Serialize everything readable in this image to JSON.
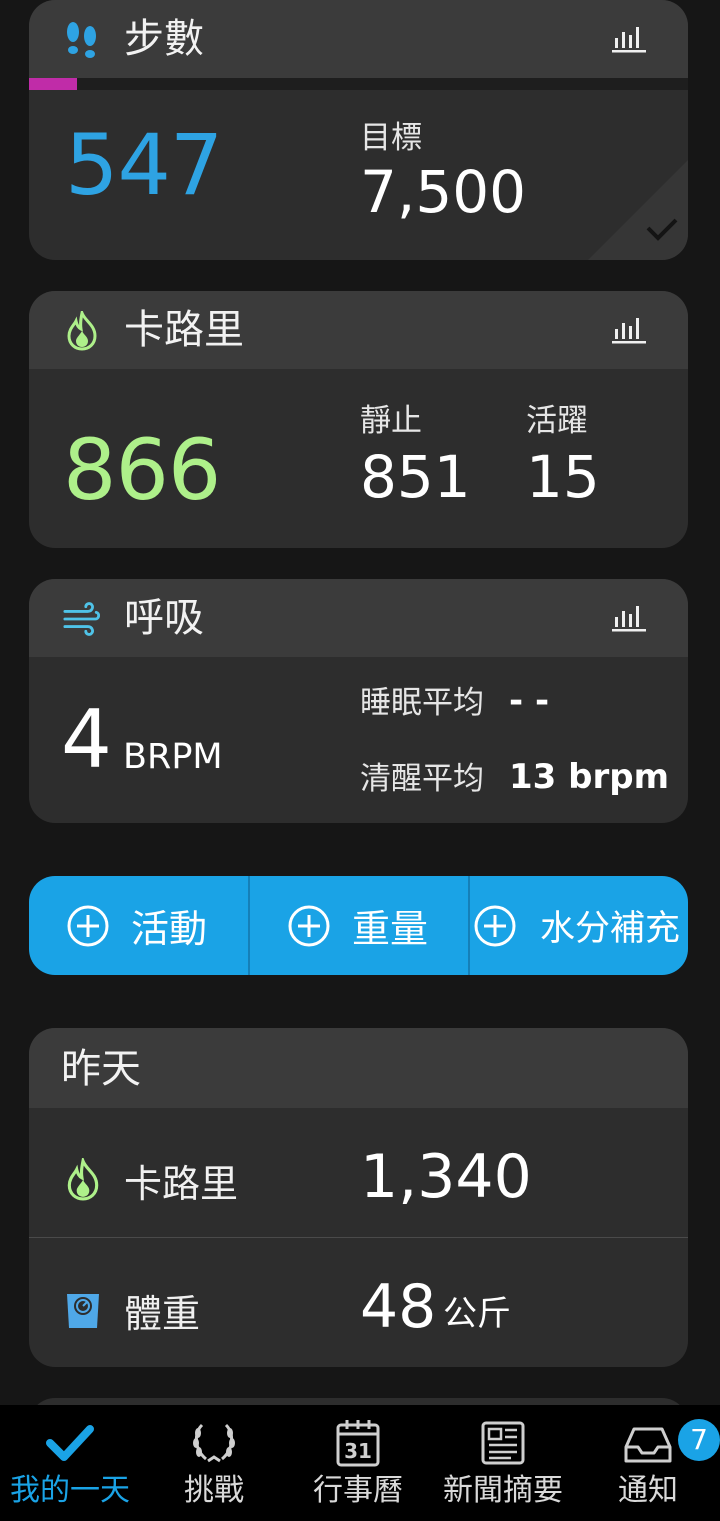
{
  "colors": {
    "accent_blue": "#1aa3e6",
    "steps_blue": "#2ea3e3",
    "calorie_green": "#aef08a",
    "progress_magenta": "#c02ca8",
    "card_bg": "#2d2d2d",
    "header_bg": "#3b3b3b"
  },
  "steps": {
    "icon": "footprints-icon",
    "title": "步數",
    "value": "547",
    "goal_label": "目標",
    "goal_value": "7,500",
    "progress_fraction": 0.073
  },
  "calories": {
    "icon": "flame-icon",
    "title": "卡路里",
    "value": "866",
    "resting_label": "靜止",
    "resting_value": "851",
    "active_label": "活躍",
    "active_value": "15"
  },
  "respiration": {
    "icon": "wind-icon",
    "title": "呼吸",
    "value": "4",
    "unit": "BRPM",
    "sleep_avg_label": "睡眠平均",
    "sleep_avg_value": "- -",
    "awake_avg_label": "清醒平均",
    "awake_avg_value": "13 brpm"
  },
  "add_buttons": [
    {
      "label": "活動"
    },
    {
      "label": "重量"
    },
    {
      "label": "水分補充"
    }
  ],
  "yesterday": {
    "title": "昨天",
    "calories_label": "卡路里",
    "calories_value": "1,340",
    "weight_label": "體重",
    "weight_value": "48",
    "weight_unit": "公斤"
  },
  "nav": {
    "items": [
      {
        "label": "我的一天",
        "icon": "checkmark-icon"
      },
      {
        "label": "挑戰",
        "icon": "laurel-icon"
      },
      {
        "label": "行事曆",
        "icon": "calendar-icon",
        "calendar_day": "31"
      },
      {
        "label": "新聞摘要",
        "icon": "newsfeed-icon"
      },
      {
        "label": "通知",
        "icon": "inbox-icon",
        "badge": "7"
      }
    ]
  }
}
